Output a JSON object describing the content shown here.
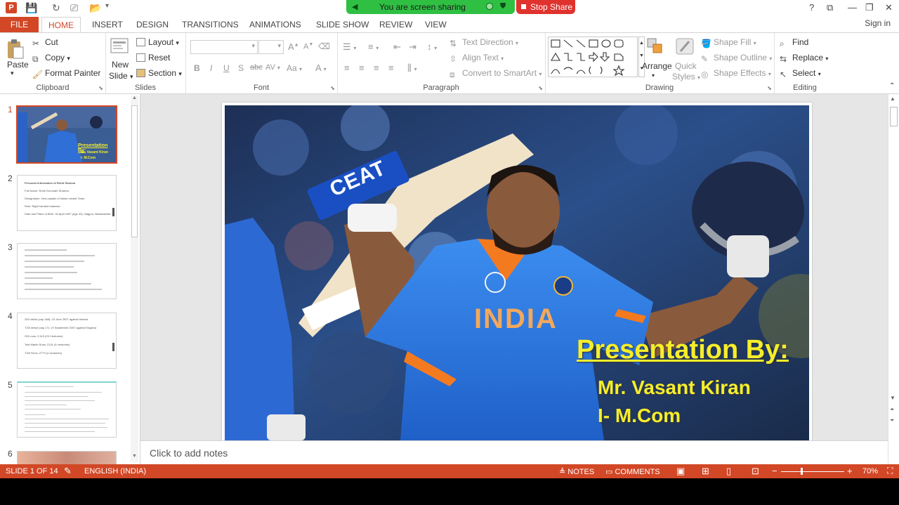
{
  "titlebar": {
    "screen_sharing_text": "You are screen sharing",
    "stop_share_label": "Stop Share",
    "help": "?",
    "minimize": "—",
    "restore": "❐",
    "close": "✕"
  },
  "tabs": [
    "FILE",
    "HOME",
    "INSERT",
    "DESIGN",
    "TRANSITIONS",
    "ANIMATIONS",
    "SLIDE SHOW",
    "REVIEW",
    "VIEW"
  ],
  "sign_in": "Sign in",
  "ribbon": {
    "clipboard": {
      "paste": "Paste",
      "cut": "Cut",
      "copy": "Copy",
      "format_painter": "Format Painter",
      "label": "Clipboard"
    },
    "slides": {
      "new_slide_line1": "New",
      "new_slide_line2": "Slide",
      "layout": "Layout",
      "reset": "Reset",
      "section": "Section",
      "label": "Slides"
    },
    "font": {
      "label": "Font",
      "bold": "B",
      "italic": "I",
      "underline": "U",
      "shadow": "S",
      "strike": "abc",
      "spacing": "AV",
      "case": "Aa",
      "grow": "A",
      "shrink": "A",
      "color": "A"
    },
    "paragraph": {
      "text_direction": "Text Direction",
      "align_text": "Align Text",
      "convert_smartart": "Convert to SmartArt",
      "label": "Paragraph"
    },
    "drawing": {
      "arrange": "Arrange",
      "quick_styles_1": "Quick",
      "quick_styles_2": "Styles",
      "shape_fill": "Shape Fill",
      "shape_outline": "Shape Outline",
      "shape_effects": "Shape Effects",
      "label": "Drawing"
    },
    "editing": {
      "find": "Find",
      "replace": "Replace",
      "select": "Select",
      "label": "Editing"
    }
  },
  "thumbnails": {
    "numbers": [
      "1",
      "2",
      "3",
      "4",
      "5",
      "6"
    ],
    "slide1_text": [
      "Presentation By:",
      "Mr. Vasant Kiran",
      "I- M.Com"
    ],
    "slide2_lines": [
      "Personal Information of Rohit Sharma",
      "Full Name: Rohit Gurunath Sharma",
      "Designation: Vice-captain of Indian cricket Team",
      "Role: Right handed batsman",
      "Date and Place of Birth: 30 April 1987 (age 33), Nagpur, Maharashtra"
    ],
    "slide4_lines": [
      "ODI debut (cap 168): 23 June 2007 against Ireland",
      "T20I debut (cap 17): 19 September 2007 against England",
      "ODI runs: 9,115 (29 Centuries)",
      "Test Match Runs: 2141 (6 centuries)",
      "T20I Runs: 2773 (4 centuries)"
    ]
  },
  "slide": {
    "bat_logo": "CEAT",
    "jersey": "INDIA",
    "title": "Presentation By:",
    "presenter": "Mr. Vasant Kiran",
    "class": "I- M.Com"
  },
  "notes_placeholder": "Click to add notes",
  "status": {
    "slide_info": "SLIDE 1 OF 14",
    "language": "ENGLISH (INDIA)",
    "notes": "NOTES",
    "comments": "COMMENTS",
    "zoom": "70%"
  },
  "colors": {
    "accent": "#d24726",
    "share_green": "#2fc043",
    "stop_red": "#e0332e",
    "slide_text_yellow": "#f5ee2c"
  }
}
